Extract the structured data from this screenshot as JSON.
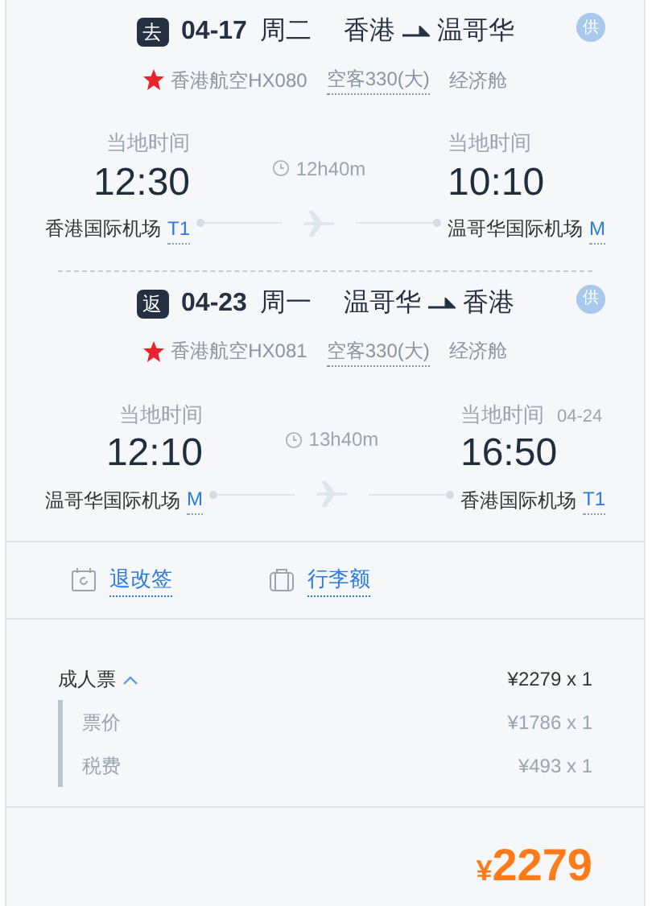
{
  "legs": [
    {
      "tag": "去",
      "date": "04-17",
      "weekday": "周二",
      "from": "香港",
      "to": "温哥华",
      "badge": "供",
      "airline": "香港航空HX080",
      "aircraft": "空客330(大)",
      "cabin": "经济舱",
      "departure": {
        "label": "当地时间",
        "time": "12:30",
        "airport": "香港国际机场",
        "terminal": "T1"
      },
      "duration": "12h40m",
      "arrival": {
        "label": "当地时间",
        "time": "10:10",
        "airport": "温哥华国际机场",
        "terminal": "M"
      }
    },
    {
      "tag": "返",
      "date": "04-23",
      "weekday": "周一",
      "from": "温哥华",
      "to": "香港",
      "badge": "供",
      "airline": "香港航空HX081",
      "aircraft": "空客330(大)",
      "cabin": "经济舱",
      "departure": {
        "label": "当地时间",
        "time": "12:10",
        "airport": "温哥华国际机场",
        "terminal": "M"
      },
      "duration": "13h40m",
      "arrival": {
        "label": "当地时间",
        "date": "04-24",
        "time": "16:50",
        "airport": "香港国际机场",
        "terminal": "T1"
      }
    }
  ],
  "links": [
    {
      "kind": "refund",
      "label": "退改签"
    },
    {
      "kind": "baggage",
      "label": "行李额"
    }
  ],
  "fare": {
    "label": "成人票",
    "expanded": true,
    "amount": "¥2279 x 1",
    "items": [
      {
        "label": "票价",
        "amount": "¥1786 x 1"
      },
      {
        "label": "税费",
        "amount": "¥493 x 1"
      }
    ]
  },
  "total": {
    "currency": "¥",
    "amount": "2279"
  }
}
